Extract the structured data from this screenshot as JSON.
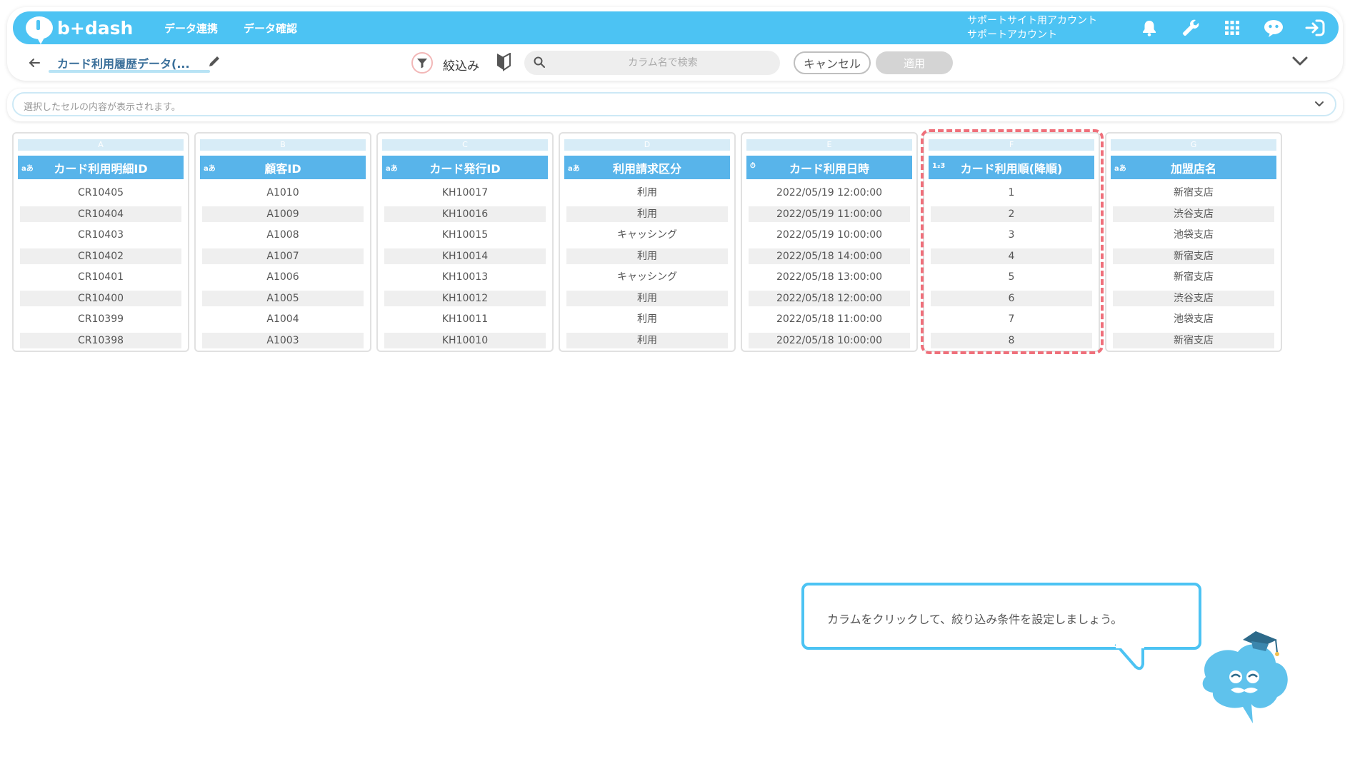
{
  "header": {
    "logo_text": "b+dash",
    "nav": [
      {
        "label": "データ連携"
      },
      {
        "label": "データ確認"
      }
    ],
    "account_site": "サポートサイト用アカウント",
    "account_name": "サポートアカウント",
    "icons": [
      "bell-icon",
      "wrench-icon",
      "apps-grid-icon",
      "chat-robot-icon",
      "logout-icon"
    ],
    "accent_color": "#4cc3f3"
  },
  "toolbar": {
    "title": "カード利用履歴データ(...",
    "filter_label": "絞込み",
    "search_placeholder": "カラム名で検索",
    "cancel_label": "キャンセル",
    "apply_label": "適用"
  },
  "cell_bar": {
    "placeholder": "選択したセルの内容が表示されます。"
  },
  "table": {
    "columns": [
      {
        "letter": "A",
        "type": "aあ",
        "name": "カード利用明細ID",
        "values": [
          "CR10405",
          "CR10404",
          "CR10403",
          "CR10402",
          "CR10401",
          "CR10400",
          "CR10399",
          "CR10398"
        ]
      },
      {
        "letter": "B",
        "type": "aあ",
        "name": "顧客ID",
        "values": [
          "A1010",
          "A1009",
          "A1008",
          "A1007",
          "A1006",
          "A1005",
          "A1004",
          "A1003"
        ]
      },
      {
        "letter": "C",
        "type": "aあ",
        "name": "カード発行ID",
        "values": [
          "KH10017",
          "KH10016",
          "KH10015",
          "KH10014",
          "KH10013",
          "KH10012",
          "KH10011",
          "KH10010"
        ]
      },
      {
        "letter": "D",
        "type": "aあ",
        "name": "利用請求区分",
        "values": [
          "利用",
          "利用",
          "キャッシング",
          "利用",
          "キャッシング",
          "利用",
          "利用",
          "利用"
        ]
      },
      {
        "letter": "E",
        "type": "⏱",
        "name": "カード利用日時",
        "values": [
          "2022/05/19 12:00:00",
          "2022/05/19 11:00:00",
          "2022/05/19 10:00:00",
          "2022/05/18 14:00:00",
          "2022/05/18 13:00:00",
          "2022/05/18 12:00:00",
          "2022/05/18 11:00:00",
          "2022/05/18 10:00:00"
        ]
      },
      {
        "letter": "F",
        "type": "1₂3",
        "name": "カード利用順(降順)",
        "values": [
          "1",
          "2",
          "3",
          "4",
          "5",
          "6",
          "7",
          "8"
        ]
      },
      {
        "letter": "G",
        "type": "aあ",
        "name": "加盟店名",
        "values": [
          "新宿支店",
          "渋谷支店",
          "池袋支店",
          "新宿支店",
          "新宿支店",
          "渋谷支店",
          "池袋支店",
          "新宿支店"
        ]
      }
    ],
    "highlight_color": "#ef6f7a"
  },
  "guide": {
    "message": "カラムをクリックして、絞り込み条件を設定しましょう。"
  }
}
